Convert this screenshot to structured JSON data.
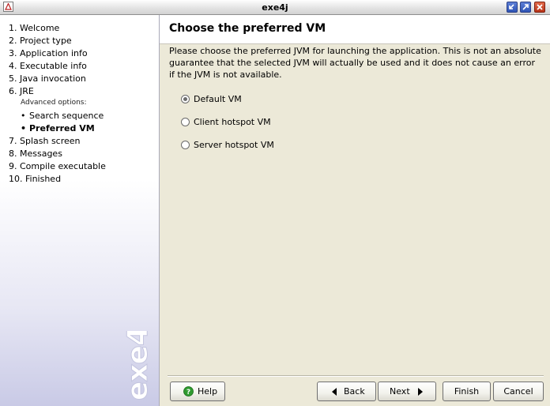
{
  "window": {
    "title": "exe4j"
  },
  "sidebar": {
    "steps": [
      "1. Welcome",
      "2. Project type",
      "3. Application info",
      "4. Executable info",
      "5. Java invocation",
      "6. JRE",
      "7. Splash screen",
      "8. Messages",
      "9. Compile executable",
      "10. Finished"
    ],
    "advanced_label": "Advanced options:",
    "sub_items": [
      "Search sequence",
      "Preferred VM"
    ],
    "watermark": "exe4j"
  },
  "main": {
    "title": "Choose the preferred VM",
    "description": "Please choose the preferred JVM for launching the application. This is not an absolute guarantee that the selected JVM will actually be used and it does not cause an error if the JVM is not available.",
    "options": [
      {
        "label": "Default VM",
        "selected": true
      },
      {
        "label": "Client hotspot VM",
        "selected": false
      },
      {
        "label": "Server hotspot VM",
        "selected": false
      }
    ]
  },
  "buttons": {
    "help": "Help",
    "back": "Back",
    "next": "Next",
    "finish": "Finish",
    "cancel": "Cancel"
  }
}
